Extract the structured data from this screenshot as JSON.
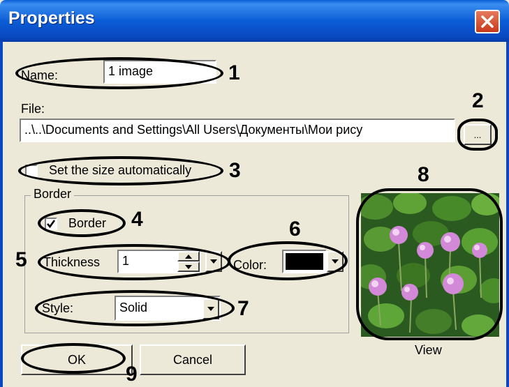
{
  "window": {
    "title": "Properties"
  },
  "fields": {
    "name_label": "Name:",
    "name_value": "1 image",
    "file_label": "File:",
    "file_value": "..\\..\\Documents and Settings\\All Users\\Документы\\Мои рису",
    "browse_label": "...",
    "auto_size_label": "Set the size automatically",
    "auto_size_checked": false
  },
  "border_group": {
    "legend": "Border",
    "border_label": "Border",
    "border_checked": true,
    "thickness_label": "Thickness",
    "thickness_value": "1",
    "color_label": "Color:",
    "color_value": "#000000",
    "style_label": "Style:",
    "style_value": "Solid"
  },
  "preview": {
    "label": "View"
  },
  "buttons": {
    "ok": "OK",
    "cancel": "Cancel"
  },
  "annotations": [
    "1",
    "2",
    "3",
    "4",
    "5",
    "6",
    "7",
    "8",
    "9"
  ],
  "colors": {
    "titlebar": "#0b5dd6",
    "dialog_bg": "#ece9d8",
    "close_button": "#c8391b"
  }
}
